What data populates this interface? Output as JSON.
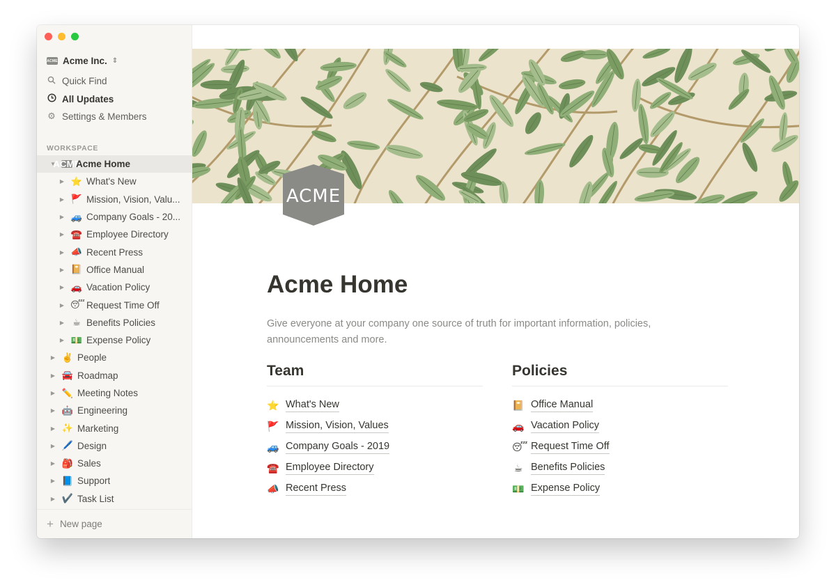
{
  "workspace": {
    "name": "Acme Inc.",
    "logo_text": "ACME"
  },
  "sidebar": {
    "quick_find": "Quick Find",
    "all_updates": "All Updates",
    "settings": "Settings & Members",
    "section_label": "WORKSPACE",
    "new_page": "New page",
    "tree": [
      {
        "label": "Acme Home",
        "emoji": "ACME",
        "level": 0,
        "expanded": true,
        "selected": true
      },
      {
        "label": "What's New",
        "emoji": "⭐",
        "level": 1
      },
      {
        "label": "Mission, Vision, Valu...",
        "emoji": "🚩",
        "level": 1
      },
      {
        "label": "Company Goals - 20...",
        "emoji": "🚙",
        "level": 1
      },
      {
        "label": "Employee Directory",
        "emoji": "☎️",
        "level": 1
      },
      {
        "label": "Recent Press",
        "emoji": "📣",
        "level": 1
      },
      {
        "label": "Office Manual",
        "emoji": "📔",
        "level": 1
      },
      {
        "label": "Vacation Policy",
        "emoji": "🚗",
        "level": 1
      },
      {
        "label": "Request Time Off",
        "emoji": "😴",
        "level": 1
      },
      {
        "label": "Benefits Policies",
        "emoji": "☕",
        "level": 1
      },
      {
        "label": "Expense Policy",
        "emoji": "💵",
        "level": 1
      },
      {
        "label": "People",
        "emoji": "✌️",
        "level": 0
      },
      {
        "label": "Roadmap",
        "emoji": "🚘",
        "level": 0
      },
      {
        "label": "Meeting Notes",
        "emoji": "✏️",
        "level": 0
      },
      {
        "label": "Engineering",
        "emoji": "🤖",
        "level": 0
      },
      {
        "label": "Marketing",
        "emoji": "✨",
        "level": 0
      },
      {
        "label": "Design",
        "emoji": "🖊️",
        "level": 0
      },
      {
        "label": "Sales",
        "emoji": "🎒",
        "level": 0
      },
      {
        "label": "Support",
        "emoji": "📘",
        "level": 0
      },
      {
        "label": "Task List",
        "emoji": "✔️",
        "level": 0
      }
    ]
  },
  "page": {
    "cover_logo_text": "ACME",
    "title": "Acme Home",
    "description": "Give everyone at your company one source of truth for important information, policies, announcements and more.",
    "team": {
      "heading": "Team",
      "links": [
        {
          "emoji": "⭐",
          "label": "What's New"
        },
        {
          "emoji": "🚩",
          "label": "Mission, Vision, Values"
        },
        {
          "emoji": "🚙",
          "label": "Company Goals - 2019"
        },
        {
          "emoji": "☎️",
          "label": "Employee Directory"
        },
        {
          "emoji": "📣",
          "label": "Recent Press"
        }
      ]
    },
    "policies": {
      "heading": "Policies",
      "links": [
        {
          "emoji": "📔",
          "label": "Office Manual"
        },
        {
          "emoji": "🚗",
          "label": "Vacation Policy"
        },
        {
          "emoji": "😴",
          "label": "Request Time Off"
        },
        {
          "emoji": "☕",
          "label": "Benefits Policies"
        },
        {
          "emoji": "💵",
          "label": "Expense Policy"
        }
      ]
    }
  },
  "colors": {
    "sidebar_bg": "#f7f6f3",
    "text": "#37352f",
    "cover_bg": "#ece3cd",
    "leaf_green": "#8fae78",
    "logo_gray": "#8a8a86"
  }
}
